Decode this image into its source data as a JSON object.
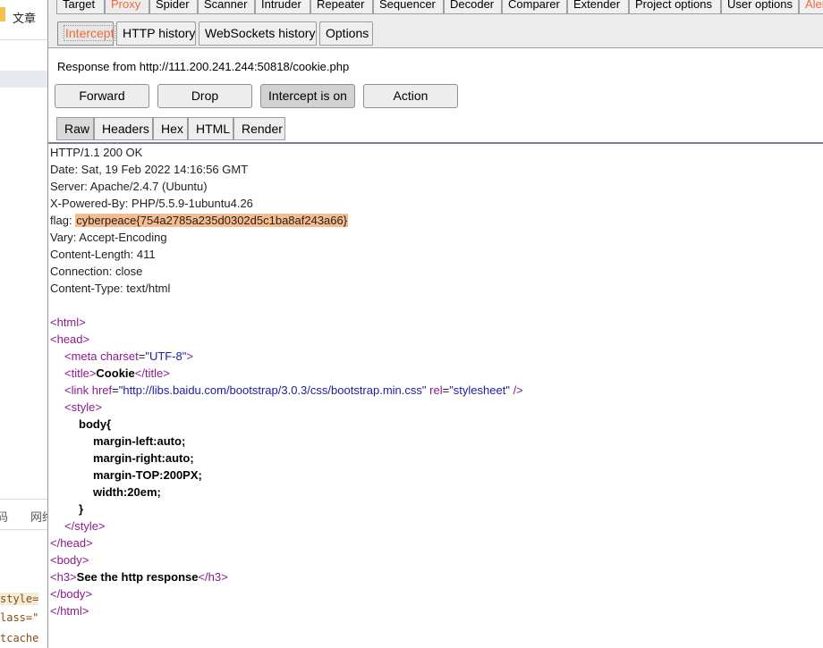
{
  "background_app": {
    "top_label": "文章",
    "mid_labels": [
      "码",
      "网络"
    ],
    "code_lines": [
      "style=",
      "lass=\"",
      "tcache"
    ]
  },
  "top_tabs": [
    "Target",
    "Proxy",
    "Spider",
    "Scanner",
    "Intruder",
    "Repeater",
    "Sequencer",
    "Decoder",
    "Comparer",
    "Extender",
    "Project options",
    "User options",
    "Alerts"
  ],
  "active_top_tab": "Proxy",
  "sub_tabs": [
    "Intercept",
    "HTTP history",
    "WebSockets history",
    "Options"
  ],
  "active_sub_tab": "Intercept",
  "response_from": "Response from http://111.200.241.244:50818/cookie.php",
  "buttons": {
    "forward": "Forward",
    "drop": "Drop",
    "intercept": "Intercept is on",
    "action": "Action"
  },
  "editor_tabs": [
    "Raw",
    "Headers",
    "Hex",
    "HTML",
    "Render"
  ],
  "active_editor_tab": "Raw",
  "response": {
    "status": "HTTP/1.1 200 OK",
    "date": "Date: Sat, 19 Feb 2022 14:16:56 GMT",
    "server": "Server: Apache/2.4.7 (Ubuntu)",
    "powered_by": "X-Powered-By: PHP/5.5.9-1ubuntu4.26",
    "flag_label": "flag: ",
    "flag_value": "cyberpeace{754a2785a235d0302d5c1ba8af243a66}",
    "vary": "Vary: Accept-Encoding",
    "content_length": "Content-Length: 411",
    "connection": "Connection: close",
    "content_type": "Content-Type: text/html"
  },
  "html_body": {
    "title_text": "Cookie",
    "meta_charset": "\"UTF-8\"",
    "link_href": "\"http://libs.baidu.com/bootstrap/3.0.3/css/bootstrap.min.css\"",
    "link_rel": "\"stylesheet\"",
    "css_lines": [
      "body{",
      "margin-left:auto;",
      "margin-right:auto;",
      "margin-TOP:200PX;",
      "width:20em;",
      "}"
    ],
    "h3_text": "See the http response"
  }
}
